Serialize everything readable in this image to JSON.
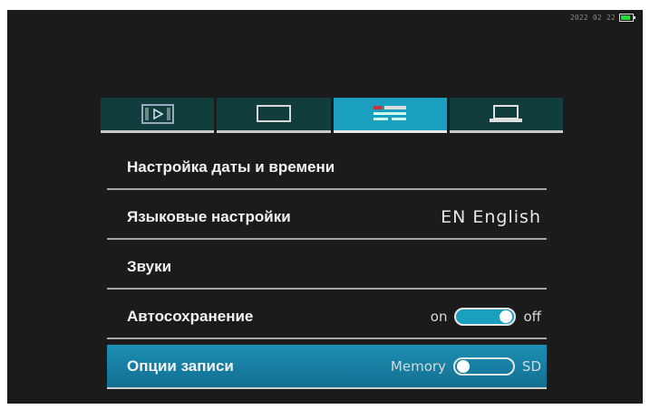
{
  "status": {
    "datetime": "2022 02 22",
    "battery_level": 0.8
  },
  "tabs": [
    {
      "icon": "playback-icon",
      "active": false
    },
    {
      "icon": "display-icon",
      "active": false
    },
    {
      "icon": "settings-icon",
      "active": true
    },
    {
      "icon": "laptop-icon",
      "active": false
    }
  ],
  "menu": {
    "date_time": {
      "label": "Настройка даты и времени"
    },
    "language": {
      "label": "Языковые настройки",
      "value": "EN English"
    },
    "sounds": {
      "label": "Звуки"
    },
    "autosave": {
      "label": "Автосохранение",
      "option_left": "on",
      "option_right": "off",
      "state": "on"
    },
    "record_options": {
      "label": "Опции записи",
      "option_left": "Memory",
      "option_right": "SD",
      "state": "Memory"
    }
  },
  "colors": {
    "accent": "#1a9fbf",
    "tab_inactive": "#123d3d",
    "background": "#1b1b1b"
  }
}
